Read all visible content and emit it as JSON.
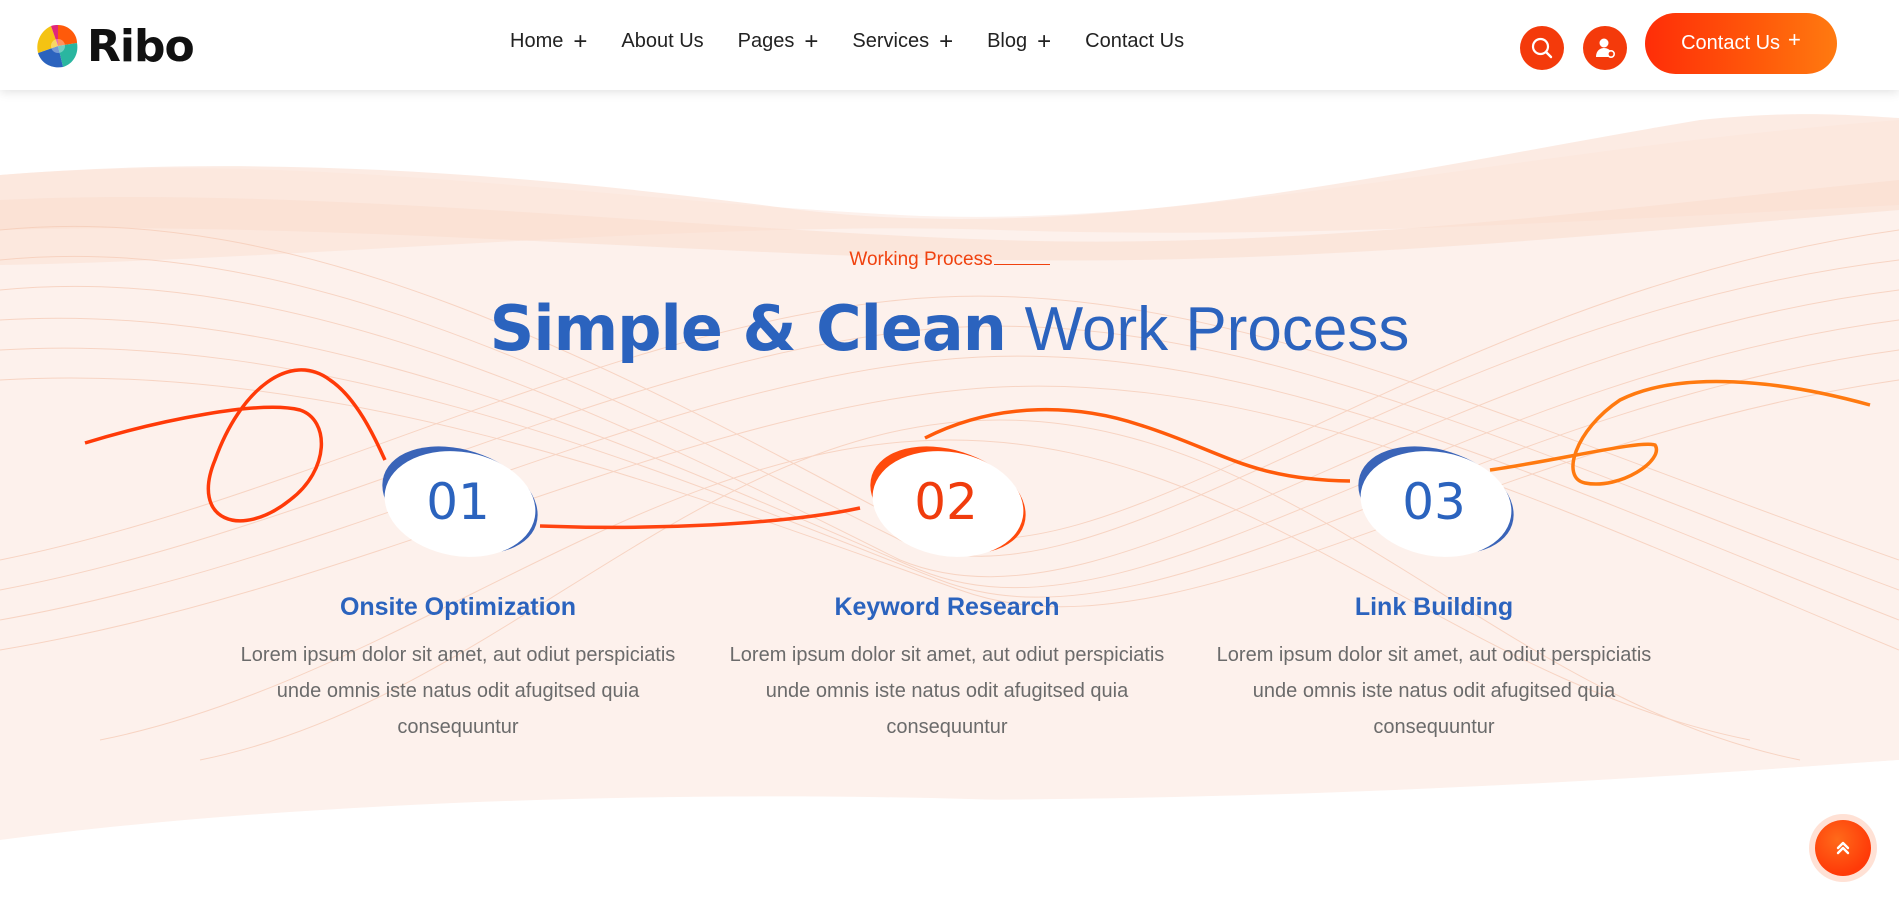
{
  "brand": {
    "name": "Ribo"
  },
  "nav": {
    "items": [
      {
        "label": "Home",
        "has_submenu": true
      },
      {
        "label": "About Us",
        "has_submenu": false
      },
      {
        "label": "Pages",
        "has_submenu": true
      },
      {
        "label": "Services",
        "has_submenu": true
      },
      {
        "label": "Blog",
        "has_submenu": true
      },
      {
        "label": "Contact Us",
        "has_submenu": false
      }
    ],
    "cta_label": "Contact Us",
    "cta_plus": "+",
    "submenu_symbol": "+"
  },
  "icons": {
    "search": "search-icon",
    "user": "user-icon",
    "scroll_top": "double-chevron-up-icon"
  },
  "colors": {
    "brand_blue": "#2b63be",
    "accent_orange": "#f43a0b",
    "section_bg": "#fdf1ec"
  },
  "process": {
    "subtitle": "Working Process",
    "title_bold": "Simple & Clean",
    "title_light": "Work Process",
    "steps": [
      {
        "number": "01",
        "title": "Onsite Optimization",
        "description_lines": [
          "Lorem ipsum dolor sit amet, aut odiut perspiciatis",
          "unde omnis iste natus odit afugitsed quia",
          "consequuntur"
        ]
      },
      {
        "number": "02",
        "title": "Keyword Research",
        "description_lines": [
          "Lorem ipsum dolor sit amet, aut odiut perspiciatis",
          "unde omnis iste natus odit afugitsed quia",
          "consequuntur"
        ]
      },
      {
        "number": "03",
        "title": "Link Building",
        "description_lines": [
          "Lorem ipsum dolor sit amet, aut odiut perspiciatis",
          "unde omnis iste natus odit afugitsed quia",
          "consequuntur"
        ]
      }
    ]
  }
}
